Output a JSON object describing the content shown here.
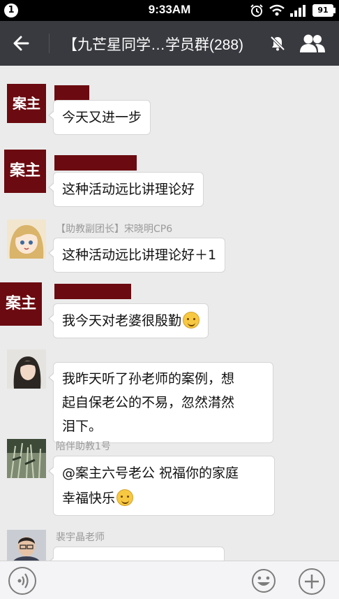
{
  "status_bar": {
    "left_badge": "1",
    "time": "9:33AM",
    "battery": "91"
  },
  "header": {
    "title": "【九芒星同学…学员群(288)"
  },
  "avatar_text": "案主",
  "messages": [
    {
      "sender": "",
      "text": "今天又进一步"
    },
    {
      "sender": "",
      "text": "这种活动远比讲理论好"
    },
    {
      "sender": "【助教副团长】宋晓明CP6",
      "text": "这种活动远比讲理论好＋1"
    },
    {
      "sender": "",
      "text": "我今天对老婆很殷勤"
    },
    {
      "sender": "",
      "text_line1": "我昨天听了孙老师的案例，想",
      "text_line2": "起自保老公的不易，忽然潸然",
      "text_line3": "泪下。"
    },
    {
      "sender": "陪伴助教1号",
      "text_line1": "@案主六号老公 祝福你的家庭",
      "text_line2": "幸福快乐"
    },
    {
      "sender": "裴宇晶老师",
      "text": ""
    }
  ],
  "colors": {
    "header_bg": "#393a3f",
    "avatar_red": "#6b0a10",
    "chat_bg": "#ebebeb"
  },
  "icons": [
    "back-arrow-icon",
    "mute-icon",
    "group-members-icon",
    "voice-icon",
    "emoji-icon",
    "plus-icon"
  ]
}
